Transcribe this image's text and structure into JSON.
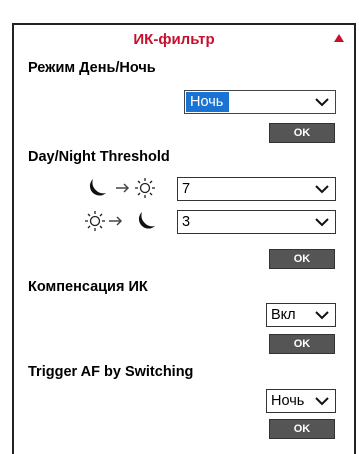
{
  "panel": {
    "title": "ИК-фильтр",
    "collapse_icon": "triangle-up-icon"
  },
  "day_night": {
    "label": "Режим День/Ночь",
    "value": "Ночь",
    "ok_label": "OK"
  },
  "threshold": {
    "label": "Day/Night Threshold",
    "night_to_day_value": "7",
    "day_to_night_value": "3",
    "ok_label": "OK",
    "icons": [
      "moon-icon",
      "arrow-right-icon",
      "sun-icon"
    ]
  },
  "ir_compensation": {
    "label": "Компенсация ИК",
    "value": "Вкл",
    "ok_label": "OK"
  },
  "trigger_af": {
    "label": "Trigger AF by Switching",
    "value": "Ночь",
    "ok_label": "OK"
  },
  "colors": {
    "title": "#c8102e",
    "button": "#555555",
    "selection": "#1a73d2"
  }
}
